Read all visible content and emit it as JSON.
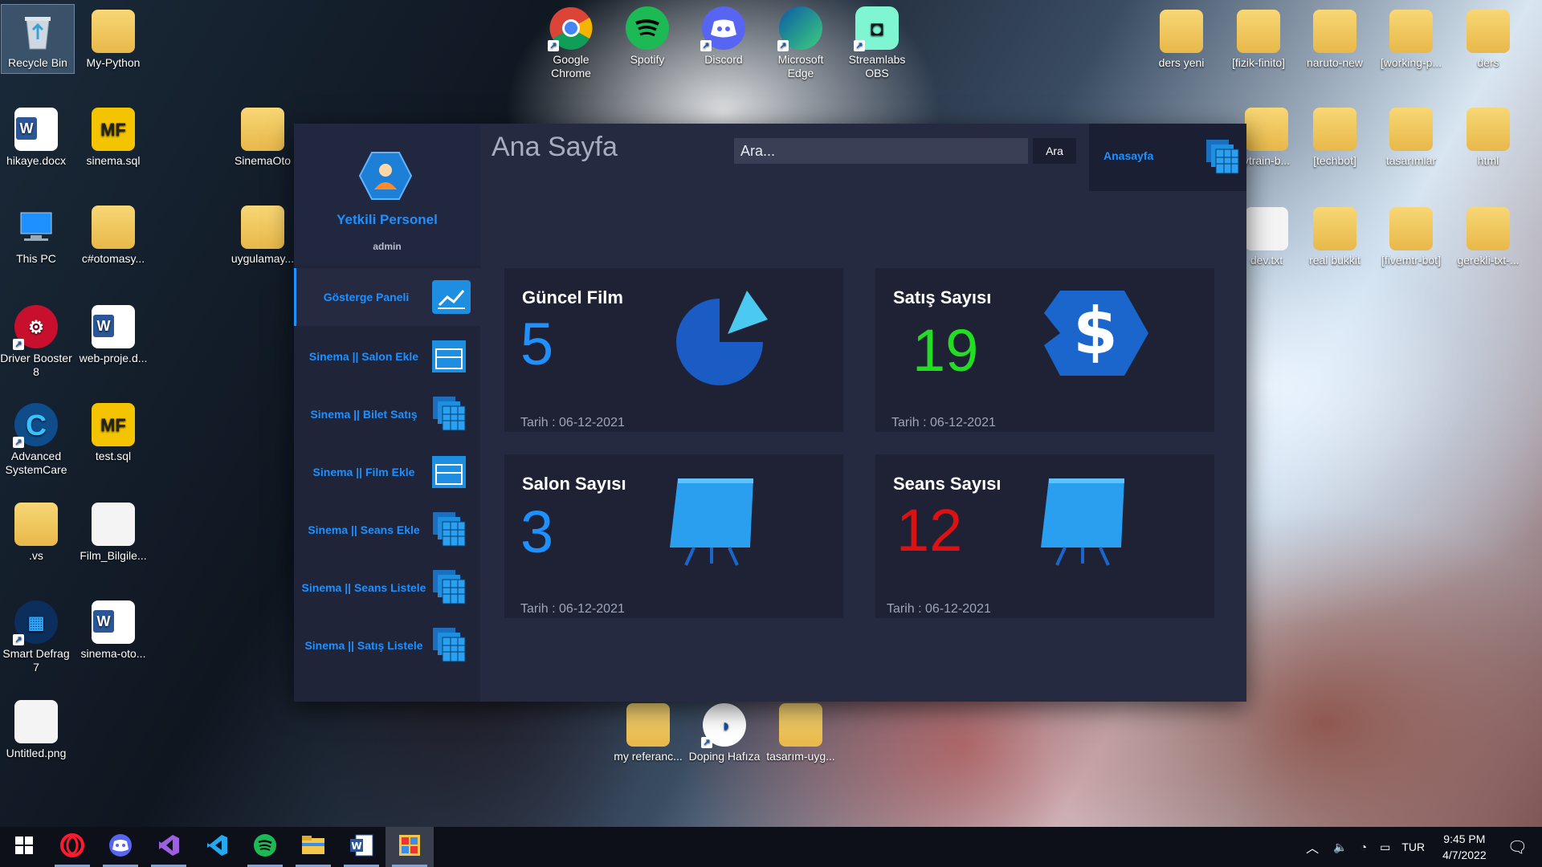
{
  "desktop": {
    "icons": [
      {
        "label": "Recycle Bin"
      },
      {
        "label": "My-Python"
      },
      {
        "label": "hikaye.docx"
      },
      {
        "label": "sinema.sql"
      },
      {
        "label": "SinemaOto"
      },
      {
        "label": "This PC"
      },
      {
        "label": "c#otomasy..."
      },
      {
        "label": "uygulamay..."
      },
      {
        "label": "Driver Booster 8"
      },
      {
        "label": "web-proje.d..."
      },
      {
        "label": "Advanced SystemCare"
      },
      {
        "label": "test.sql"
      },
      {
        "label": ".vs"
      },
      {
        "label": "Film_Bilgile..."
      },
      {
        "label": "Smart Defrag 7"
      },
      {
        "label": "sinema-oto..."
      },
      {
        "label": "Untitled.png"
      },
      {
        "label": "Google Chrome"
      },
      {
        "label": "Spotify"
      },
      {
        "label": "Discord"
      },
      {
        "label": "Microsoft Edge"
      },
      {
        "label": "Streamlabs OBS"
      },
      {
        "label": "ders yeni"
      },
      {
        "label": "[fizik-finito]"
      },
      {
        "label": "naruto-new"
      },
      {
        "label": "[working-p..."
      },
      {
        "label": "ders"
      },
      {
        "label": "ytrain-b..."
      },
      {
        "label": "[techbot]"
      },
      {
        "label": "tasarımlar"
      },
      {
        "label": "html"
      },
      {
        "label": "dev.txt"
      },
      {
        "label": "real bukkit"
      },
      {
        "label": "[fivemtr-bot]"
      },
      {
        "label": "gerekli-txt-..."
      },
      {
        "label": "my referanc..."
      },
      {
        "label": "Doping Hafıza"
      },
      {
        "label": "tasarım-uyg..."
      }
    ]
  },
  "app": {
    "profile": {
      "name": "Yetkili Personel",
      "role": "admin"
    },
    "nav": [
      {
        "label": "Gösterge Paneli"
      },
      {
        "label": "Sinema || Salon Ekle"
      },
      {
        "label": "Sinema || Bilet Satış"
      },
      {
        "label": "Sinema || Film Ekle"
      },
      {
        "label": "Sinema || Seans Ekle"
      },
      {
        "label": "Sinema || Seans Listele"
      },
      {
        "label": "Sinema || Satış Listele"
      }
    ],
    "title": "Ana Sayfa",
    "search": {
      "placeholder": "Ara...",
      "button": "Ara"
    },
    "home_label": "Anasayfa",
    "cards": [
      {
        "title": "Güncel Film",
        "value": "5",
        "date": "Tarih : 06-12-2021",
        "color": "#1e90ff"
      },
      {
        "title": "Satış Sayısı",
        "value": "19",
        "date": "Tarih : 06-12-2021",
        "color": "#22dd22"
      },
      {
        "title": "Salon Sayısı",
        "value": "3",
        "date": "Tarih : 06-12-2021",
        "color": "#1e90ff"
      },
      {
        "title": "Seans Sayısı",
        "value": "12",
        "date": "Tarih : 06-12-2021",
        "color": "#dd1111"
      }
    ]
  },
  "taskbar": {
    "lang": "TUR",
    "time": "9:45 PM",
    "date": "4/7/2022",
    "apps": [
      "start-icon",
      "opera-icon",
      "discord-icon",
      "visual-studio-icon",
      "vscode-icon",
      "spotify-icon",
      "file-explorer-icon",
      "word-icon",
      "app-window-icon"
    ]
  }
}
